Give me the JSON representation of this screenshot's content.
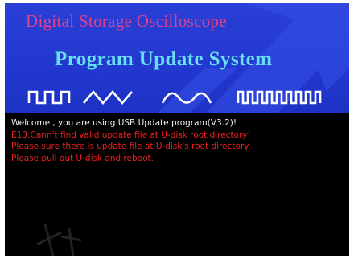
{
  "banner": {
    "title": "Digital Storage Oscilloscope",
    "subtitle": "Program Update System",
    "waveform_icons": [
      "square-wave-icon",
      "triangle-wave-icon",
      "sine-wave-icon",
      "pulse-train-icon"
    ]
  },
  "console": {
    "lines": [
      {
        "text": "Welcome , you are using USB Update program(V3.2)!",
        "color": "#f2f2f2"
      },
      {
        "text": "E13:Cann't find valid update file at U-disk root directory!",
        "color": "#e82020"
      },
      {
        "text": "Please sure there is update file at U-disk's root directory.",
        "color": "#e82020"
      },
      {
        "text": "Please pull out U-disk and reboot.",
        "color": "#e82020"
      }
    ]
  },
  "colors": {
    "banner_blue": "#2238cf",
    "title_pink": "#e0428f",
    "subtitle_cyan": "#67e0f0",
    "background": "#000000"
  }
}
